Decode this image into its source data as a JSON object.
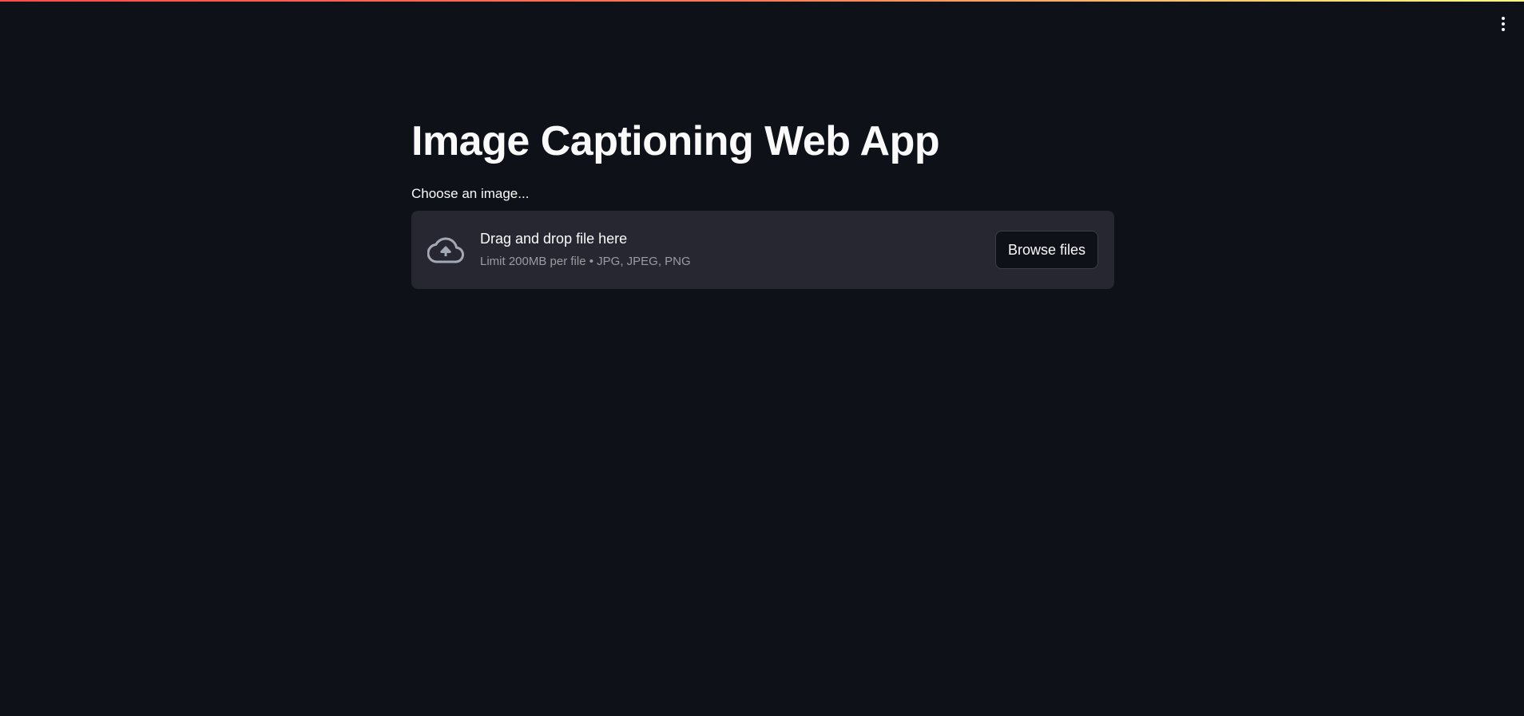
{
  "app": {
    "title": "Image Captioning Web App"
  },
  "uploader": {
    "label": "Choose an image...",
    "dropzone_title": "Drag and drop file here",
    "dropzone_hint": "Limit 200MB per file • JPG, JPEG, PNG",
    "browse_label": "Browse files",
    "icon": "cloud-upload-icon"
  },
  "header": {
    "menu_icon": "vertical-dots-icon"
  },
  "colors": {
    "background": "#0e1117",
    "surface": "#262730",
    "text": "#fafafa",
    "muted_text": "#9a9ca3",
    "accent_gradient_start": "#ff4b4b",
    "accent_gradient_end": "#fffd80"
  }
}
